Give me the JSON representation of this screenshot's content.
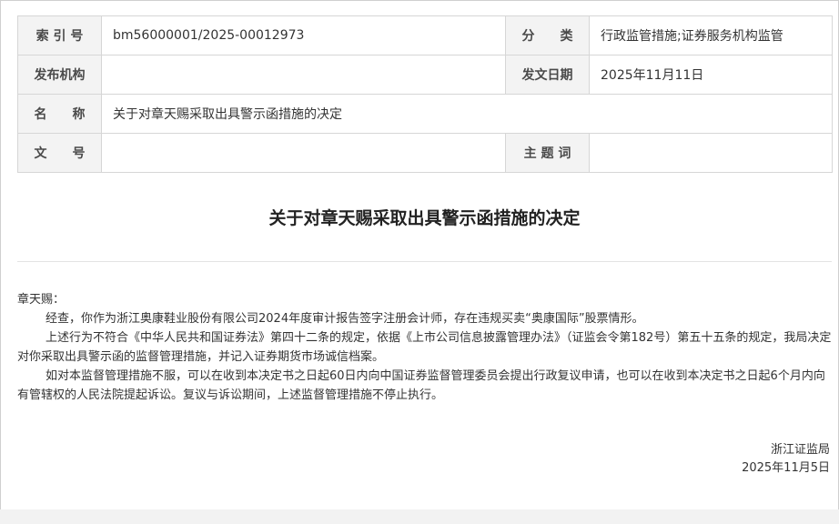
{
  "meta": {
    "index_no_label": "索 引 号",
    "index_no": "bm56000001/2025-00012973",
    "category_label": "分　　类",
    "category": "行政监管措施;证券服务机构监管",
    "issuer_label": "发布机构",
    "issuer": "",
    "date_label": "发文日期",
    "date": "2025年11月11日",
    "name_label": "名　　称",
    "name": "关于对章天赐采取出具警示函措施的决定",
    "doc_no_label": "文　　号",
    "doc_no": "",
    "keyword_label": "主 题 词",
    "keyword": ""
  },
  "document": {
    "title": "关于对章天赐采取出具警示函措施的决定",
    "salutation": "章天赐：",
    "paragraphs": [
      "经查，你作为浙江奥康鞋业股份有限公司2024年度审计报告签字注册会计师，存在违规买卖“奥康国际”股票情形。",
      "上述行为不符合《中华人民共和国证券法》第四十二条的规定，依据《上市公司信息披露管理办法》（证监会令第182号）第五十五条的规定，我局决定对你采取出具警示函的监督管理措施，并记入证券期货市场诚信档案。",
      "如对本监督管理措施不服，可以在收到本决定书之日起60日内向中国证券监督管理委员会提出行政复议申请，也可以在收到本决定书之日起6个月内向有管辖权的人民法院提起诉讼。复议与诉讼期间，上述监督管理措施不停止执行。"
    ],
    "signature": "浙江证监局",
    "sign_date": "2025年11月5日"
  }
}
